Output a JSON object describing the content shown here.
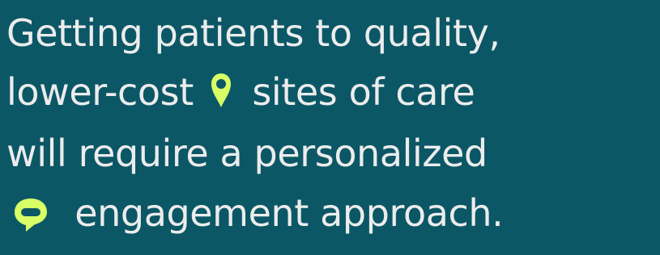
{
  "headline": {
    "line1": "Getting patients to quality,",
    "line2_before_icon": "lower-cost",
    "line2_after_icon": "sites of care",
    "line3": "will require a personalized",
    "line4_after_icon": "engagement approach."
  },
  "icons": {
    "pin": "location-pin-icon",
    "bubble": "chat-bubble-icon"
  },
  "colors": {
    "background": "#0b5766",
    "text": "#ececec",
    "accent": "#d8ff66",
    "accent_hole": "#0b5766"
  }
}
